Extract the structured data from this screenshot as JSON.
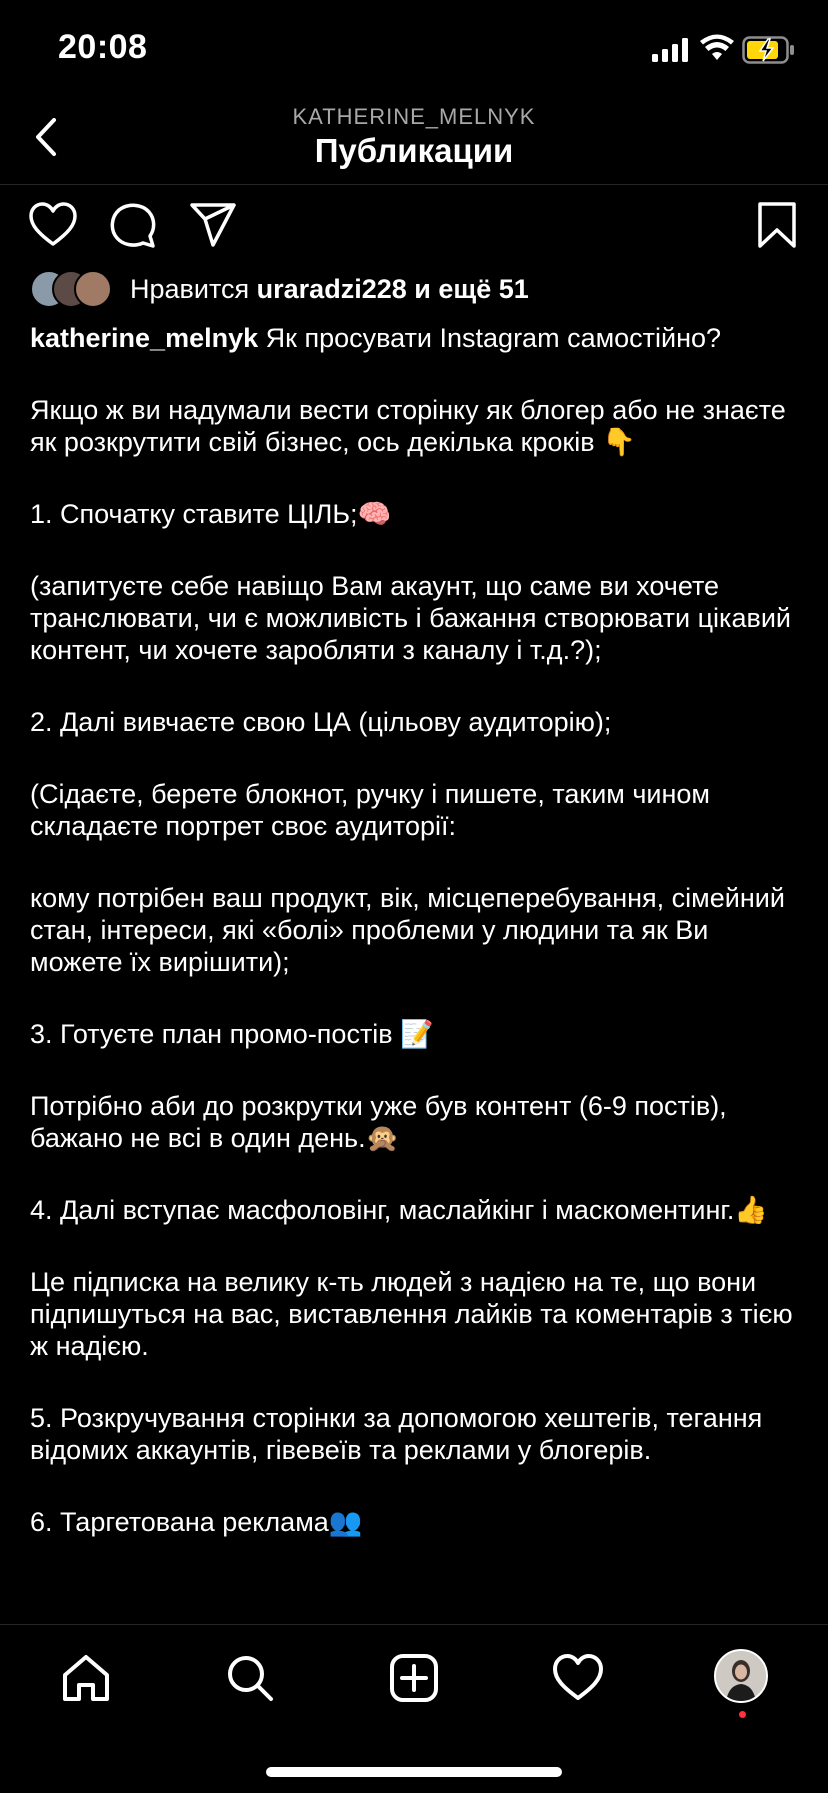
{
  "status": {
    "time": "20:08"
  },
  "header": {
    "username": "KATHERINE_MELNYK",
    "title": "Публикации"
  },
  "likes": {
    "prefix": "Нравится",
    "user": "uraradzi228",
    "and": "и",
    "more": "ещё 51"
  },
  "caption": {
    "username": "katherine_melnyk",
    "first_line": "Як просувати Instagram самостійно?",
    "paragraphs": [
      "Якщо ж ви надумали вести сторінку як блогер або не знаєте як розкрутити свій бізнес, ось декілька кроків 👇",
      "1. Спочатку ставите ЦІЛЬ;🧠",
      "(запитуєте себе навіщо Вам акаунт, що саме ви хочете транслювати, чи є можливість і бажання створювати цікавий контент, чи хочете заробляти з каналу і т.д.?);",
      "2. Далі вивчаєте свою ЦА (цільову аудиторію);",
      "(Сідаєте, берете блокнот, ручку і пишете, таким чином складаєте портрет своє аудиторії:",
      "кому потрібен ваш продукт, вік, місцеперебування, сімейний стан, інтереси, які «болі» проблеми у людини та як Ви можете їх вирішити);",
      "3. Готуєте план промо-постів 📝",
      "Потрібно аби до розкрутки уже був контент (6-9 постів), бажано не всі в один день.🙊",
      "4. Далі вступає масфоловінг, маслайкінг і маскоментинг.👍",
      "Це підписка на велику к-ть людей з надією на те, що вони підпишуться на вас, виставлення лайків та коментарів з тією ж надією.",
      "5. Розкручування сторінки за допомогою хештегів, тегання відомих аккаунтів, гівевеїв та реклами у блогерів.",
      "6. Таргетована реклама👥"
    ]
  },
  "icons": {
    "back": "chevron-left-icon",
    "like": "heart-icon",
    "comment": "comment-icon",
    "share": "paper-plane-icon",
    "save": "bookmark-icon",
    "tabs": [
      "home-icon",
      "search-icon",
      "plus-square-icon",
      "heart-icon",
      "profile-avatar"
    ]
  },
  "colors": {
    "background": "#000000",
    "text": "#ffffff",
    "muted": "#a8a8a8",
    "battery": "#ffd60a",
    "notification": "#ff3040"
  }
}
